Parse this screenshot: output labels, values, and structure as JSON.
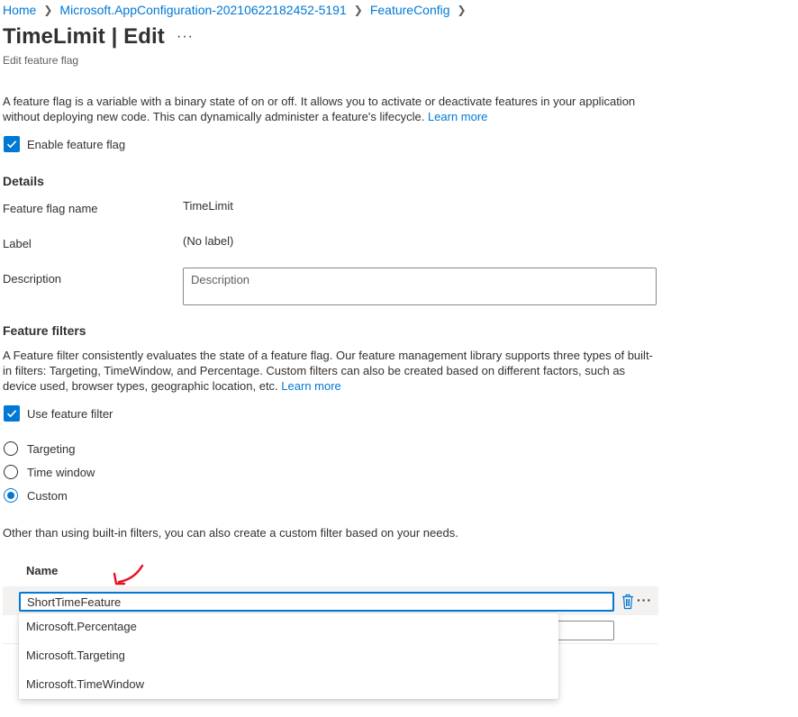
{
  "breadcrumb": [
    "Home",
    "Microsoft.AppConfiguration-20210622182452-5191",
    "FeatureConfig"
  ],
  "header": {
    "title": "TimeLimit | Edit",
    "more_label": "···",
    "subtitle": "Edit feature flag"
  },
  "intro": {
    "text": "A feature flag is a variable with a binary state of on or off. It allows you to activate or deactivate features in your application without deploying new code. This can dynamically administer a feature's lifecycle.",
    "learn_more": "Learn more"
  },
  "enable_flag": {
    "label": "Enable feature flag",
    "checked": true
  },
  "details": {
    "heading": "Details",
    "name_label": "Feature flag name",
    "name_value": "TimeLimit",
    "label_label": "Label",
    "label_value": "(No label)",
    "description_label": "Description",
    "description_placeholder": "Description"
  },
  "filters": {
    "heading": "Feature filters",
    "text": "A Feature filter consistently evaluates the state of a feature flag. Our feature management library supports three types of built-in filters: Targeting, TimeWindow, and Percentage. Custom filters can also be created based on different factors, such as device used, browser types, geographic location, etc.",
    "learn_more": "Learn more",
    "use_filter_label": "Use feature filter",
    "use_filter_checked": true,
    "options": [
      {
        "label": "Targeting",
        "selected": false
      },
      {
        "label": "Time window",
        "selected": false
      },
      {
        "label": "Custom",
        "selected": true
      }
    ]
  },
  "custom": {
    "text": "Other than using built-in filters, you can also create a custom filter based on your needs.",
    "name_header": "Name",
    "name_value": "ShortTimeFeature",
    "row_more_label": "···",
    "suggestions": [
      "Microsoft.Percentage",
      "Microsoft.Targeting",
      "Microsoft.TimeWindow"
    ]
  },
  "colors": {
    "accent": "#0078d4",
    "text": "#323130",
    "annotation": "#e81123"
  },
  "icons": [
    "chevron-right-icon",
    "checkmark-icon",
    "trash-icon",
    "more-icon",
    "red-arrow-annotation"
  ]
}
